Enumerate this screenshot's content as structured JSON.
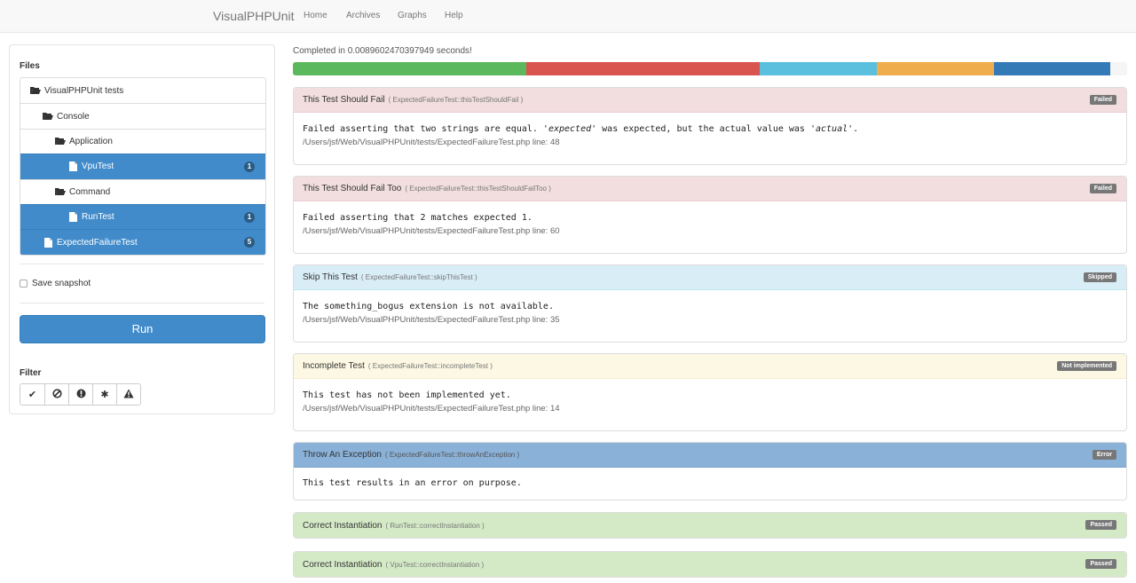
{
  "navbar": {
    "brand": "VisualPHPUnit",
    "links": [
      "Home",
      "Archives",
      "Graphs",
      "Help"
    ]
  },
  "sidebar": {
    "files_heading": "Files",
    "tree": [
      {
        "label": "VisualPHPUnit tests",
        "icon": "folder-open-icon",
        "level": 0,
        "active": false,
        "count": ""
      },
      {
        "label": "Console",
        "icon": "folder-open-icon",
        "level": 1,
        "active": false,
        "count": ""
      },
      {
        "label": "Application",
        "icon": "folder-open-icon",
        "level": 2,
        "active": false,
        "count": ""
      },
      {
        "label": "VpuTest",
        "icon": "file-icon",
        "level": 3,
        "active": true,
        "count": "1"
      },
      {
        "label": "Command",
        "icon": "folder-open-icon",
        "level": 2,
        "active": false,
        "count": ""
      },
      {
        "label": "RunTest",
        "icon": "file-icon",
        "level": 3,
        "active": true,
        "count": "1"
      },
      {
        "label": "ExpectedFailureTest",
        "icon": "file-icon",
        "level": 1,
        "active": true,
        "count": "5"
      }
    ],
    "save_snapshot_label": "Save snapshot",
    "run_label": "Run",
    "filter_heading": "Filter",
    "filters": [
      {
        "name": "filter-passed-button",
        "icon": "check-icon",
        "glyph": "✔"
      },
      {
        "name": "filter-skipped-button",
        "icon": "ban-icon",
        "glyph": "⊘"
      },
      {
        "name": "filter-error-button",
        "icon": "exclamation-circle-icon",
        "glyph": "❗"
      },
      {
        "name": "filter-incomplete-button",
        "icon": "asterisk-icon",
        "glyph": "✱"
      },
      {
        "name": "filter-failed-button",
        "icon": "warning-icon",
        "glyph": "⚠"
      }
    ]
  },
  "summary": {
    "completed_text": "Completed in 0.0089602470397949 seconds!"
  },
  "progress": {
    "segments": [
      {
        "status": "passed",
        "fraction": 0.28,
        "color": "#5cb85c"
      },
      {
        "status": "failed",
        "fraction": 0.28,
        "color": "#d9534f"
      },
      {
        "status": "skipped",
        "fraction": 0.14,
        "color": "#5bc0de"
      },
      {
        "status": "incomplete",
        "fraction": 0.14,
        "color": "#f0ad4e"
      },
      {
        "status": "error",
        "fraction": 0.14,
        "color": "#337ab7"
      }
    ]
  },
  "results": [
    {
      "title": "This Test Should Fail",
      "method": "( ExpectedFailureTest::thisTestShouldFail )",
      "status": "Failed",
      "kind": "failed",
      "message": [
        "Failed asserting that two strings are equal. '",
        "expected",
        "' was expected, but the actual value was '",
        "actual",
        "'."
      ],
      "location": "/Users/jsf/Web/VisualPHPUnit/tests/ExpectedFailureTest.php line: 48"
    },
    {
      "title": "This Test Should Fail Too",
      "method": "( ExpectedFailureTest::thisTestShouldFailToo )",
      "status": "Failed",
      "kind": "failed",
      "message_plain": "Failed asserting that 2 matches expected 1.",
      "location": "/Users/jsf/Web/VisualPHPUnit/tests/ExpectedFailureTest.php line: 60"
    },
    {
      "title": "Skip This Test",
      "method": "( ExpectedFailureTest::skipThisTest )",
      "status": "Skipped",
      "kind": "skipped",
      "message_plain": "The something_bogus extension is not available.",
      "location": "/Users/jsf/Web/VisualPHPUnit/tests/ExpectedFailureTest.php line: 35"
    },
    {
      "title": "Incomplete Test",
      "method": "( ExpectedFailureTest::incompleteTest )",
      "status": "Not implemented",
      "kind": "notimpl",
      "message_plain": "This test has not been implemented yet.",
      "location": "/Users/jsf/Web/VisualPHPUnit/tests/ExpectedFailureTest.php line: 14"
    },
    {
      "title": "Throw An Exception",
      "method": "( ExpectedFailureTest::throwAnException )",
      "status": "Error",
      "kind": "error",
      "message_plain": "This test results in an error on purpose."
    },
    {
      "title": "Correct Instantiation",
      "method": "( RunTest::correctInstantiation )",
      "status": "Passed",
      "kind": "passed"
    },
    {
      "title": "Correct Instantiation",
      "method": "( VpuTest::correctInstantiation )",
      "status": "Passed",
      "kind": "passed"
    }
  ]
}
